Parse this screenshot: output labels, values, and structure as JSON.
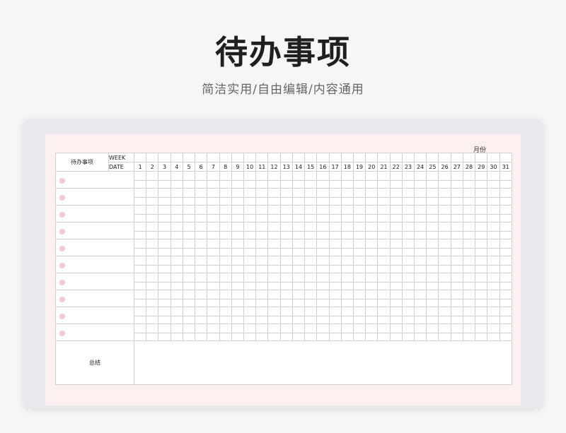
{
  "header": {
    "title": "待办事项",
    "subtitle": "简洁实用/自由编辑/内容通用"
  },
  "sheet": {
    "month_label": "月份",
    "corner_label": "待办事项",
    "week_label": "WEEK",
    "date_label": "DATE",
    "days": [
      1,
      2,
      3,
      4,
      5,
      6,
      7,
      8,
      9,
      10,
      11,
      12,
      13,
      14,
      15,
      16,
      17,
      18,
      19,
      20,
      21,
      22,
      23,
      24,
      25,
      26,
      27,
      28,
      29,
      30,
      31
    ],
    "task_rows": 10,
    "summary_label": "总结"
  },
  "colors": {
    "pink_cell": "#fadadd",
    "sheet_bg": "#fdf0f0",
    "bullet": "#f5c9cf"
  }
}
